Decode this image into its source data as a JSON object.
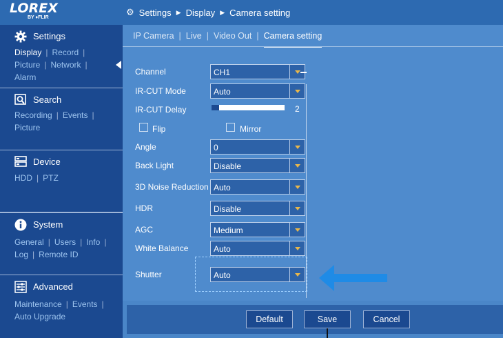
{
  "logo": {
    "brand": "LOREX",
    "sub": "BY ♦FLIR"
  },
  "breadcrumb": {
    "items": [
      "Settings",
      "Display",
      "Camera setting"
    ]
  },
  "sidebar": {
    "settings": {
      "title": "Settings",
      "links": [
        "Display",
        "Record",
        "Picture",
        "Network",
        "Alarm"
      ]
    },
    "search": {
      "title": "Search",
      "links": [
        "Recording",
        "Events",
        "Picture"
      ]
    },
    "device": {
      "title": "Device",
      "links": [
        "HDD",
        "PTZ"
      ]
    },
    "system": {
      "title": "System",
      "links": [
        "General",
        "Users",
        "Info",
        "Log",
        "Remote ID"
      ]
    },
    "advanced": {
      "title": "Advanced",
      "links": [
        "Maintenance",
        "Events",
        "Auto Upgrade"
      ]
    }
  },
  "tabs": [
    "IP Camera",
    "Live",
    "Video Out",
    "Camera setting"
  ],
  "form": {
    "channel": {
      "label": "Channel",
      "value": "CH1"
    },
    "ircut_mode": {
      "label": "IR-CUT Mode",
      "value": "Auto"
    },
    "ircut_delay": {
      "label": "IR-CUT Delay",
      "value": "2",
      "level": 0.1
    },
    "flip": {
      "label": "Flip",
      "checked": false
    },
    "mirror": {
      "label": "Mirror",
      "checked": false
    },
    "angle": {
      "label": "Angle",
      "value": "0"
    },
    "backlight": {
      "label": "Back Light",
      "value": "Disable"
    },
    "noise": {
      "label": "3D Noise Reduction",
      "value": "Auto"
    },
    "hdr": {
      "label": "HDR",
      "value": "Disable"
    },
    "agc": {
      "label": "AGC",
      "value": "Medium"
    },
    "white_balance": {
      "label": "White Balance",
      "value": "Auto"
    },
    "shutter": {
      "label": "Shutter",
      "value": "Auto"
    }
  },
  "buttons": {
    "default": "Default",
    "save": "Save",
    "cancel": "Cancel"
  },
  "colors": {
    "sidebar": "#1b4990",
    "panel": "#4f8bcd",
    "arrow": "#1f8be6",
    "dropdown_arrow": "#e8b74b"
  },
  "icons": [
    "gear-icon",
    "search-icon",
    "device-icon",
    "info-icon",
    "sliders-icon",
    "dropdown-arrow-icon",
    "pointer-arrow-icon"
  ]
}
